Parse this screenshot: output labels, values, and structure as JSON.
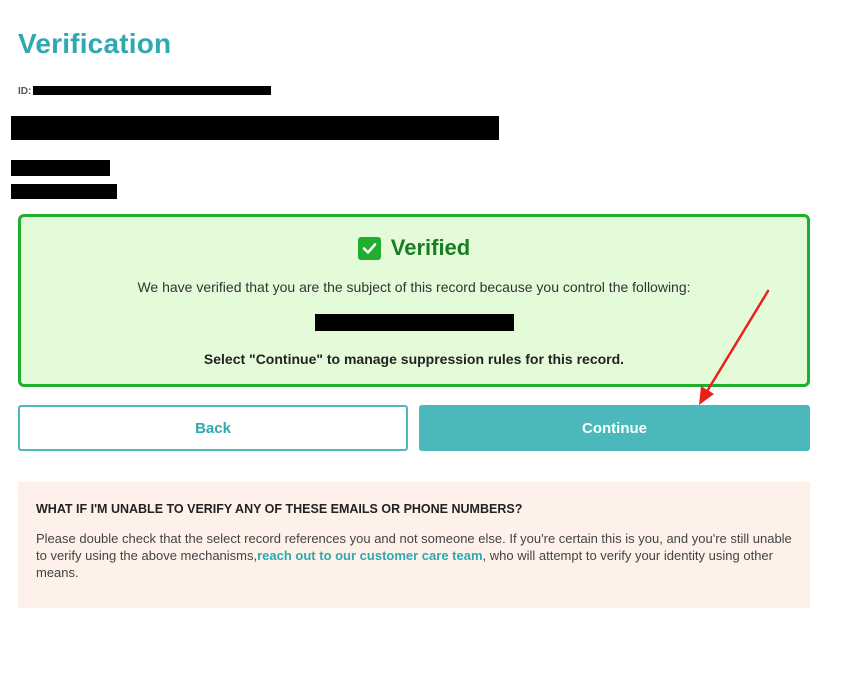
{
  "header": {
    "title": "Verification",
    "id_label": "ID:"
  },
  "verified": {
    "status": "Verified",
    "description": "We have verified that you are the subject of this record because you control the following:",
    "instruction": "Select \"Continue\" to manage suppression rules for this record."
  },
  "buttons": {
    "back_label": "Back",
    "continue_label": "Continue"
  },
  "help": {
    "title": "WHAT IF I'M UNABLE TO VERIFY ANY OF THESE EMAILS OR PHONE NUMBERS?",
    "text_before": "Please double check that the select record references you and not someone else. If you're certain this is you, and you're still unable to verify using the above mechanisms,",
    "link": "reach out to our customer care team",
    "text_after": ", who will attempt to verify your identity using other means."
  },
  "colors": {
    "accent": "#4bb8bc",
    "title": "#2fa8b0",
    "verified_border": "#1fae2e",
    "verified_bg": "#e3fbd9",
    "help_bg": "#fdf1e9",
    "arrow": "#e8221b"
  },
  "icons": {
    "check": "checkbox-checked-icon",
    "annotation": "red-arrow-icon"
  }
}
